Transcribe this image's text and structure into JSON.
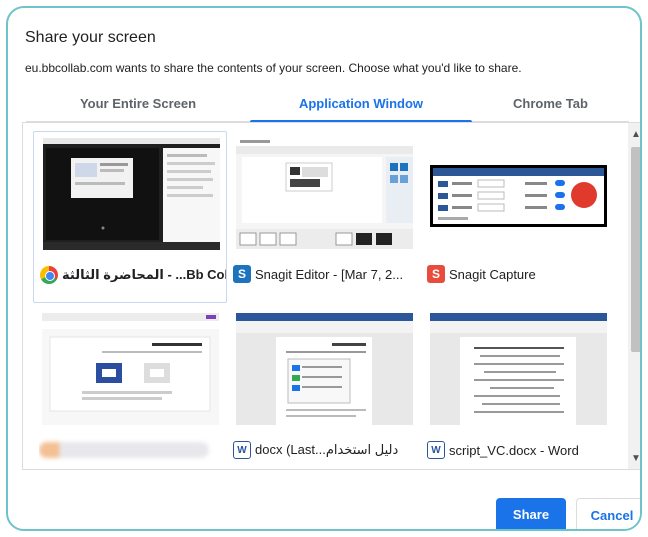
{
  "dialog": {
    "title": "Share your screen",
    "subtitle": "eu.bbcollab.com wants to share the contents of your screen. Choose what you'd like to share."
  },
  "tabs": [
    {
      "label": "Your Entire Screen",
      "active": false
    },
    {
      "label": "Application Window",
      "active": true
    },
    {
      "label": "Chrome Tab",
      "active": false
    }
  ],
  "windows": [
    {
      "title": "المحاضرة الثالثة - ...Bb Col",
      "icon": "chrome-icon",
      "selected": true
    },
    {
      "title": "Snagit Editor - [Mar 7, 2...",
      "icon": "snagit-icon",
      "selected": false
    },
    {
      "title": "Snagit Capture",
      "icon": "snagit-capture-icon",
      "selected": false
    },
    {
      "title": "",
      "icon": "blurred-label",
      "selected": false
    },
    {
      "title": "docx (Last...دليل استخدام",
      "icon": "word-icon",
      "selected": false
    },
    {
      "title": "script_VC.docx - Word",
      "icon": "word-icon",
      "selected": false
    }
  ],
  "buttons": {
    "share": "Share",
    "cancel": "Cancel"
  },
  "colors": {
    "accent": "#1a73e8",
    "frame": "#6cc3c9"
  }
}
